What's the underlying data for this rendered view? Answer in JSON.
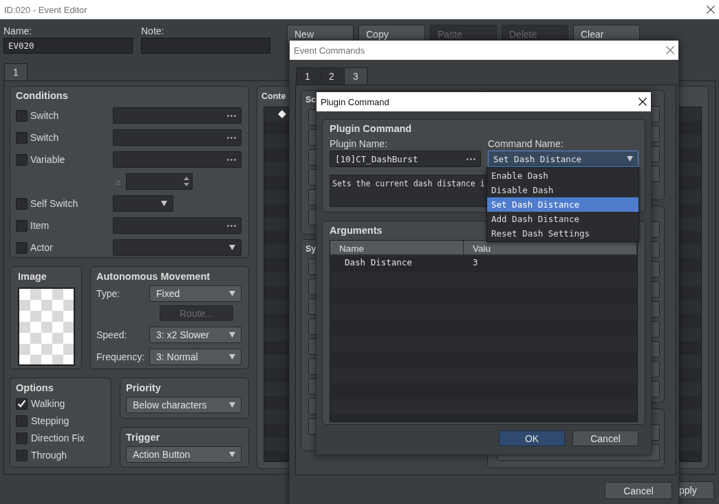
{
  "window": {
    "title": "ID:020 - Event Editor"
  },
  "name": {
    "label": "Name:",
    "value": "EV020"
  },
  "note": {
    "label": "Note:"
  },
  "toolbar": [
    {
      "label": "New",
      "disabled": false
    },
    {
      "label": "Copy",
      "disabled": false
    },
    {
      "label": "Paste",
      "disabled": true
    },
    {
      "label": "Delete",
      "disabled": true
    },
    {
      "label": "Clear",
      "disabled": false
    }
  ],
  "pages": [
    {
      "label": "1",
      "selected": true
    }
  ],
  "conditions": {
    "title": "Conditions",
    "rows": [
      {
        "label": "Switch",
        "checked": false,
        "kind": "picker"
      },
      {
        "label": "Switch",
        "checked": false,
        "kind": "picker"
      },
      {
        "label": "Variable",
        "checked": false,
        "kind": "picker",
        "compare": "≥"
      },
      {
        "label": "Self Switch",
        "checked": false,
        "kind": "short-select"
      },
      {
        "label": "Item",
        "checked": false,
        "kind": "picker"
      },
      {
        "label": "Actor",
        "checked": false,
        "kind": "select"
      }
    ]
  },
  "image": {
    "title": "Image"
  },
  "movement": {
    "title": "Autonomous Movement",
    "fields": [
      {
        "label": "Type:",
        "value": "Fixed"
      },
      {
        "label": "Speed:",
        "value": "3: x2 Slower"
      },
      {
        "label": "Frequency:",
        "value": "3: Normal"
      }
    ],
    "route": {
      "label": "Route...",
      "disabled": true
    }
  },
  "options": {
    "title": "Options",
    "items": [
      {
        "label": "Walking",
        "checked": true
      },
      {
        "label": "Stepping",
        "checked": false
      },
      {
        "label": "Direction Fix",
        "checked": false
      },
      {
        "label": "Through",
        "checked": false
      }
    ]
  },
  "priority": {
    "title": "Priority",
    "value": "Below characters"
  },
  "trigger": {
    "title": "Trigger",
    "value": "Action Button"
  },
  "contents": {
    "title": "Conte"
  },
  "apply_button": {
    "label": "pply"
  },
  "event_commands": {
    "title": "Event Commands",
    "tabs": [
      {
        "label": "1",
        "selected": false
      },
      {
        "label": "2",
        "selected": false
      },
      {
        "label": "3",
        "selected": true
      }
    ],
    "left_groups": [
      {
        "title": "Sc"
      },
      {
        "title": "Sy"
      }
    ],
    "cancel": "Cancel"
  },
  "plugin_command": {
    "title": "Plugin Command",
    "group_title": "Plugin Command",
    "plugin_label": "Plugin Name:",
    "plugin_value": "[10]CT_DashBurst",
    "command_label": "Command Name:",
    "command_value": "Set Dash Distance",
    "description": "Sets the current dash distance i",
    "arguments": {
      "title": "Arguments",
      "columns": [
        "Name",
        "Valu"
      ],
      "rows": [
        [
          "Dash Distance",
          "3"
        ]
      ]
    },
    "ok": "OK",
    "cancel": "Cancel"
  },
  "command_menu": [
    {
      "label": "Enable Dash",
      "selected": false
    },
    {
      "label": "Disable Dash",
      "selected": false
    },
    {
      "label": "Set Dash Distance",
      "selected": true
    },
    {
      "label": "Add Dash Distance",
      "selected": false
    },
    {
      "label": "Reset Dash Settings",
      "selected": false
    }
  ]
}
